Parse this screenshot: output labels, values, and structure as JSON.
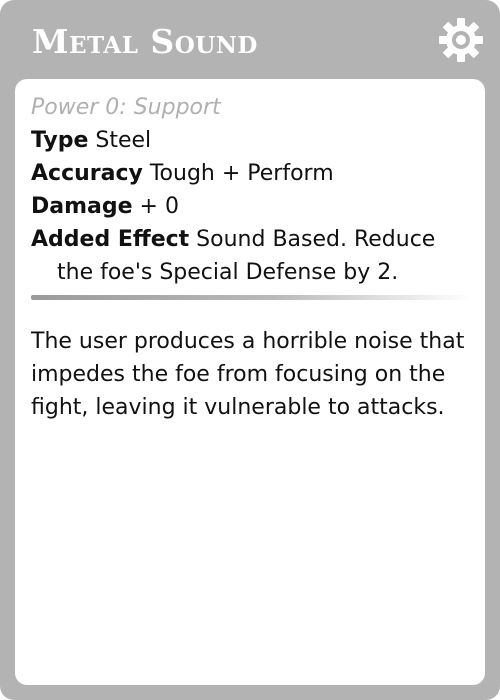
{
  "header": {
    "title": "Metal Sound",
    "settings_icon": "gear-icon"
  },
  "move": {
    "power_line": "Power 0: Support",
    "type_label": "Type",
    "type_value": " Steel",
    "accuracy_label": "Accuracy",
    "accuracy_value": " Tough + Perform",
    "damage_label": "Damage",
    "damage_value": " + 0",
    "effect_label": "Added Effect",
    "effect_value": " Sound Based. Reduce the foe's Special Defense by 2.",
    "description": "The user produces a horrible noise that impedes the foe from focusing on the fight, leaving it vulnerable to attacks."
  },
  "colors": {
    "card_frame": "#b3b3b3",
    "panel": "#ffffff",
    "title_text": "#ffffff",
    "muted_text": "#b0b0b0"
  }
}
